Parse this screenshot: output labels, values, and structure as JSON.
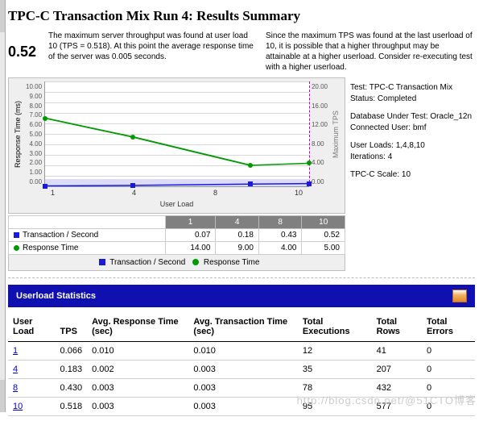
{
  "title": "TPC-C Transaction Mix Run 4: Results Summary",
  "tps_big": "0.52",
  "summary_left": "The maximum server throughput was found at user load 10 (TPS = 0.518).  At this point the average response time of the server was 0.005 seconds.",
  "summary_right": "Since the maximum TPS was found at the last userload of 10, it is possible that a higher throughput may be attainable at a higher userload. Consider re-executing test with a higher userload.",
  "info": {
    "test_label": "Test:",
    "test": "TPC-C Transaction Mix",
    "status_label": "Status:",
    "status": "Completed",
    "db_label": "Database Under Test:",
    "db": "Oracle_12n",
    "user_label": "Connected User:",
    "user": "bmf",
    "loads_label": "User Loads:",
    "loads": "1,4,8,10",
    "iter_label": "Iterations:",
    "iter": "4",
    "scale_label": "TPC-C Scale:",
    "scale": "10"
  },
  "chart_data": {
    "type": "line",
    "xlabel": "User Load",
    "x": [
      1,
      4,
      8,
      10
    ],
    "y1": {
      "label": "Response Time (ms)",
      "ticks": [
        "10.00",
        "9.00",
        "8.00",
        "7.00",
        "6.00",
        "5.00",
        "4.00",
        "3.00",
        "2.00",
        "1.00",
        "0.00"
      ],
      "range": [
        0,
        10
      ]
    },
    "y2": {
      "label": "Maximum TPS",
      "ticks": [
        "20.00",
        "16.00",
        "12.00",
        "8.00",
        "4.00",
        "0.00"
      ],
      "range": [
        0,
        20
      ]
    },
    "series": [
      {
        "name": "Transaction / Second",
        "color": "#1a1adf",
        "axis": "y2",
        "values": [
          0.07,
          0.18,
          0.43,
          0.52
        ]
      },
      {
        "name": "Response Time",
        "color": "#009a00",
        "axis": "y1",
        "values": [
          6.5,
          4.7,
          2.0,
          2.2
        ]
      }
    ],
    "max_tps_marker_x": 10,
    "baseline_band_y1": 0.7
  },
  "mini_table": {
    "headers": [
      "1",
      "4",
      "8",
      "10"
    ],
    "rows": [
      {
        "label": "Transaction / Second",
        "vals": [
          "0.07",
          "0.18",
          "0.43",
          "0.52"
        ]
      },
      {
        "label": "Response Time",
        "vals": [
          "14.00",
          "9.00",
          "4.00",
          "5.00"
        ]
      }
    ]
  },
  "legend": {
    "a": "Transaction / Second",
    "b": "Response Time"
  },
  "stats_header": "Userload Statistics",
  "stats_cols": [
    "User Load",
    "TPS",
    "Avg. Response Time (sec)",
    "Avg. Transaction Time (sec)",
    "Total Executions",
    "Total Rows",
    "Total Errors"
  ],
  "stats_rows": [
    {
      "ul": "1",
      "tps": "0.066",
      "art": "0.010",
      "att": "0.010",
      "exec": "12",
      "rows": "41",
      "err": "0"
    },
    {
      "ul": "4",
      "tps": "0.183",
      "art": "0.002",
      "att": "0.003",
      "exec": "35",
      "rows": "207",
      "err": "0"
    },
    {
      "ul": "8",
      "tps": "0.430",
      "art": "0.003",
      "att": "0.003",
      "exec": "78",
      "rows": "432",
      "err": "0"
    },
    {
      "ul": "10",
      "tps": "0.518",
      "art": "0.003",
      "att": "0.003",
      "exec": "95",
      "rows": "577",
      "err": "0"
    }
  ],
  "watermark": "http://blog.csdn.net/@51CTO博客",
  "colors": {
    "tps": "#1a1adf",
    "resp": "#009a00"
  }
}
